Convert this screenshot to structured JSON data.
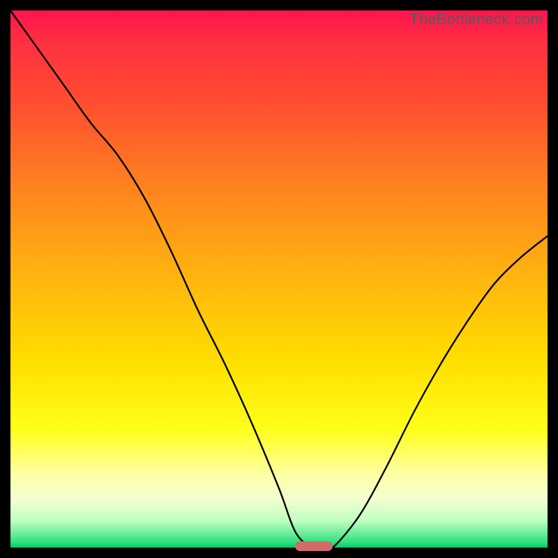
{
  "watermark": "TheBottleneck.com",
  "colors": {
    "frame": "#000000",
    "gradient_top": "#ff1450",
    "gradient_bottom": "#00cc66",
    "line": "#000000",
    "marker": "#d46a6a"
  },
  "chart_data": {
    "type": "line",
    "title": "",
    "xlabel": "",
    "ylabel": "",
    "xlim": [
      0,
      100
    ],
    "ylim": [
      0,
      100
    ],
    "x": [
      0,
      5,
      10,
      15,
      20,
      25,
      30,
      35,
      40,
      45,
      50,
      53,
      56,
      58,
      60,
      65,
      70,
      75,
      80,
      85,
      90,
      95,
      100
    ],
    "values": [
      100,
      93,
      86,
      79,
      73,
      65,
      55,
      44,
      34,
      23,
      11,
      3,
      0,
      0,
      0,
      6,
      15,
      25,
      34,
      42,
      49,
      54,
      58
    ],
    "marker": {
      "x_start": 53,
      "x_end": 60,
      "y": 0
    },
    "annotations": []
  }
}
